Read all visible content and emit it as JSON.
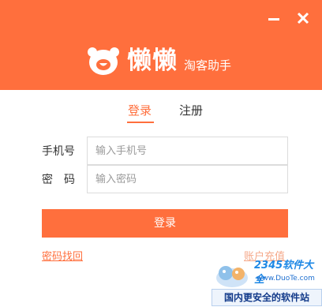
{
  "window": {
    "minimize_icon": "minimize-icon",
    "close_icon": "close-icon"
  },
  "brand": {
    "logo_icon": "bear-face-icon",
    "name": "懒懒",
    "subtitle": "淘客助手",
    "accent_color": "#ff6f3d"
  },
  "tabs": [
    {
      "label": "登录",
      "active": true
    },
    {
      "label": "注册",
      "active": false
    }
  ],
  "form": {
    "phone_label": "手机号",
    "phone_placeholder": "输入手机号",
    "password_label": "密　码",
    "password_placeholder": "输入密码",
    "submit_label": "登录"
  },
  "links": {
    "forgot_password": "密码找回",
    "recharge": "账户充值"
  },
  "watermark": {
    "brand": "2345软件大全",
    "url": "www.DuoTe.com",
    "tagline": "国内更安全的软件站"
  }
}
